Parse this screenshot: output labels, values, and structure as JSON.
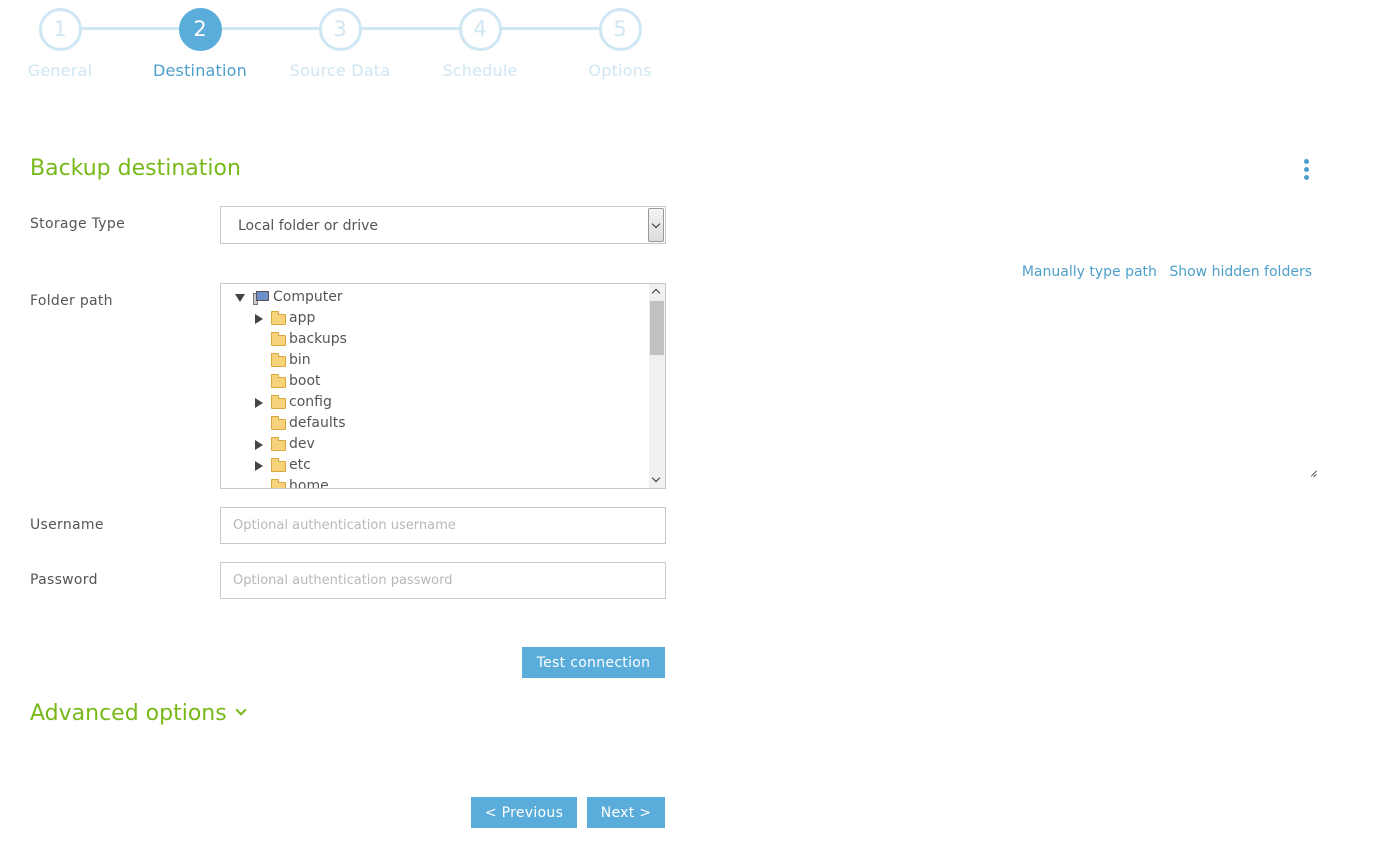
{
  "wizard": {
    "steps": [
      {
        "number": "1",
        "label": "General"
      },
      {
        "number": "2",
        "label": "Destination"
      },
      {
        "number": "3",
        "label": "Source Data"
      },
      {
        "number": "4",
        "label": "Schedule"
      },
      {
        "number": "5",
        "label": "Options"
      }
    ],
    "active_step": 2
  },
  "section": {
    "title": "Backup destination"
  },
  "storage_type": {
    "label": "Storage Type",
    "selected": "Local folder or drive"
  },
  "folder_path": {
    "label": "Folder path",
    "links": {
      "manual": "Manually type path",
      "hidden": "Show hidden folders"
    },
    "tree": [
      {
        "name": "Computer",
        "icon": "computer-icon",
        "expanded": true,
        "has_children": true
      },
      {
        "name": "app",
        "icon": "folder-icon",
        "has_children": true
      },
      {
        "name": "backups",
        "icon": "folder-icon",
        "has_children": false
      },
      {
        "name": "bin",
        "icon": "folder-icon",
        "has_children": false
      },
      {
        "name": "boot",
        "icon": "folder-icon",
        "has_children": false
      },
      {
        "name": "config",
        "icon": "folder-icon",
        "has_children": true
      },
      {
        "name": "defaults",
        "icon": "folder-icon",
        "has_children": false
      },
      {
        "name": "dev",
        "icon": "folder-icon",
        "has_children": true
      },
      {
        "name": "etc",
        "icon": "folder-icon",
        "has_children": true
      },
      {
        "name": "home",
        "icon": "folder-icon",
        "has_children": false
      }
    ]
  },
  "username": {
    "label": "Username",
    "placeholder": "Optional authentication username"
  },
  "password": {
    "label": "Password",
    "placeholder": "Optional authentication password"
  },
  "buttons": {
    "test": "Test connection",
    "previous": "< Previous",
    "next": "Next >"
  },
  "advanced": {
    "label": "Advanced options"
  },
  "colors": {
    "accent_green": "#78b91a",
    "accent_blue": "#5aaddb",
    "inactive_step": "#cfe6f3"
  }
}
